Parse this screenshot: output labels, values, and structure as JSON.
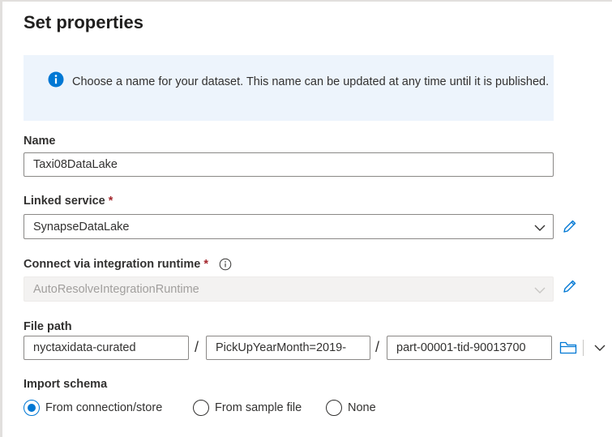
{
  "title": "Set properties",
  "info": {
    "icon": "info-icon",
    "text": "Choose a name for your dataset. This name can be updated at any time until it is published."
  },
  "name": {
    "label": "Name",
    "value": "Taxi08DataLake"
  },
  "linked_service": {
    "label": "Linked service",
    "required_mark": "*",
    "value": "SynapseDataLake"
  },
  "integration_runtime": {
    "label": "Connect via integration runtime",
    "required_mark": "*",
    "value": "AutoResolveIntegrationRuntime"
  },
  "file_path": {
    "label": "File path",
    "container": "nyctaxidata-curated",
    "directory": "PickUpYearMonth=2019-",
    "file": "part-00001-tid-90013700",
    "separator": "/"
  },
  "import_schema": {
    "label": "Import schema",
    "options": [
      "From connection/store",
      "From sample file",
      "None"
    ],
    "selected": "From connection/store"
  },
  "colors": {
    "accent": "#0078d4",
    "info_bg": "#edf4fc",
    "required": "#a4262c"
  }
}
